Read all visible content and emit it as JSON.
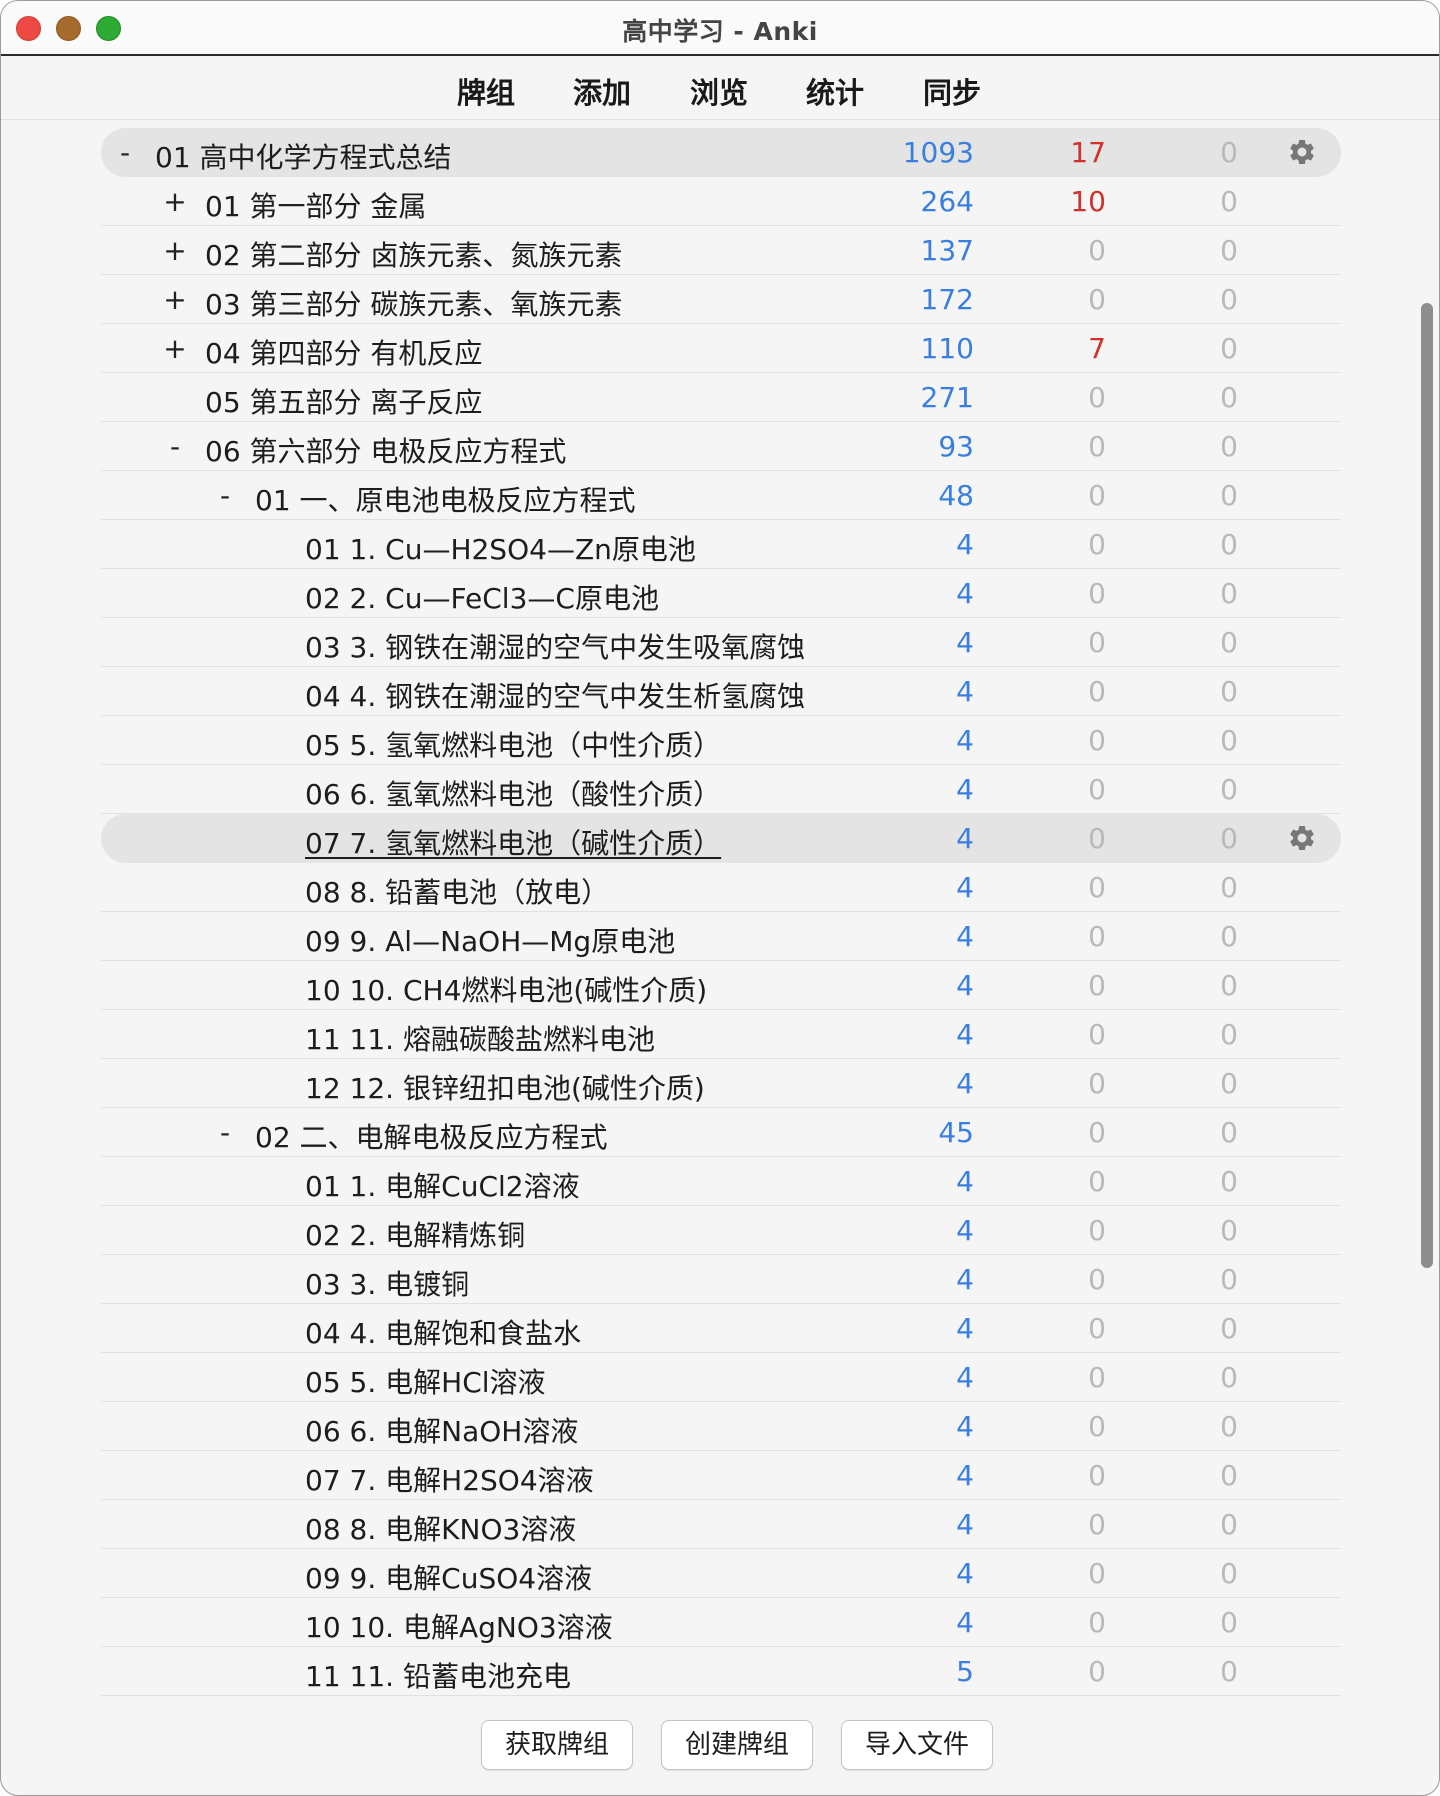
{
  "window": {
    "title": "高中学习 - Anki"
  },
  "toolbar": {
    "decks": "牌组",
    "add": "添加",
    "browse": "浏览",
    "stats": "统计",
    "sync": "同步"
  },
  "decks": [
    {
      "expander": "-",
      "name": "01 高中化学方程式总结",
      "new": "1093",
      "learn": "17",
      "review": "0",
      "level": 0,
      "gear": true,
      "current": true
    },
    {
      "expander": "+",
      "name": "01 第一部分 金属",
      "new": "264",
      "learn": "10",
      "review": "0",
      "level": 1
    },
    {
      "expander": "+",
      "name": "02 第二部分 卤族元素、氮族元素",
      "new": "137",
      "learn": "0",
      "review": "0",
      "level": 1
    },
    {
      "expander": "+",
      "name": "03 第三部分 碳族元素、氧族元素",
      "new": "172",
      "learn": "0",
      "review": "0",
      "level": 1
    },
    {
      "expander": "+",
      "name": "04 第四部分 有机反应",
      "new": "110",
      "learn": "7",
      "review": "0",
      "level": 1
    },
    {
      "expander": "",
      "name": "05 第五部分 离子反应",
      "new": "271",
      "learn": "0",
      "review": "0",
      "level": 1
    },
    {
      "expander": "-",
      "name": "06 第六部分 电极反应方程式",
      "new": "93",
      "learn": "0",
      "review": "0",
      "level": 1
    },
    {
      "expander": "-",
      "name": "01 一、原电池电极反应方程式",
      "new": "48",
      "learn": "0",
      "review": "0",
      "level": 2
    },
    {
      "expander": "",
      "name": "01 1.  Cu—H2SO4—Zn原电池",
      "new": "4",
      "learn": "0",
      "review": "0",
      "level": 3
    },
    {
      "expander": "",
      "name": "02 2.  Cu—FeCl3—C原电池",
      "new": "4",
      "learn": "0",
      "review": "0",
      "level": 3
    },
    {
      "expander": "",
      "name": "03 3.  钢铁在潮湿的空气中发生吸氧腐蚀",
      "new": "4",
      "learn": "0",
      "review": "0",
      "level": 3
    },
    {
      "expander": "",
      "name": "04 4.  钢铁在潮湿的空气中发生析氢腐蚀",
      "new": "4",
      "learn": "0",
      "review": "0",
      "level": 3
    },
    {
      "expander": "",
      "name": "05 5.  氢氧燃料电池（中性介质）",
      "new": "4",
      "learn": "0",
      "review": "0",
      "level": 3
    },
    {
      "expander": "",
      "name": "06 6.  氢氧燃料电池（酸性介质）",
      "new": "4",
      "learn": "0",
      "review": "0",
      "level": 3
    },
    {
      "expander": "",
      "name": "07 7.  氢氧燃料电池（碱性介质）",
      "new": "4",
      "learn": "0",
      "review": "0",
      "level": 3,
      "gear": true,
      "current": true,
      "selected": true
    },
    {
      "expander": "",
      "name": "08 8.  铅蓄电池（放电）",
      "new": "4",
      "learn": "0",
      "review": "0",
      "level": 3
    },
    {
      "expander": "",
      "name": "09 9.  Al—NaOH—Mg原电池",
      "new": "4",
      "learn": "0",
      "review": "0",
      "level": 3
    },
    {
      "expander": "",
      "name": "10 10.  CH4燃料电池(碱性介质)",
      "new": "4",
      "learn": "0",
      "review": "0",
      "level": 3
    },
    {
      "expander": "",
      "name": "11 11.  熔融碳酸盐燃料电池",
      "new": "4",
      "learn": "0",
      "review": "0",
      "level": 3
    },
    {
      "expander": "",
      "name": "12 12.  银锌纽扣电池(碱性介质)",
      "new": "4",
      "learn": "0",
      "review": "0",
      "level": 3
    },
    {
      "expander": "-",
      "name": "02 二、电解电极反应方程式",
      "new": "45",
      "learn": "0",
      "review": "0",
      "level": 2
    },
    {
      "expander": "",
      "name": "01 1.  电解CuCl2溶液",
      "new": "4",
      "learn": "0",
      "review": "0",
      "level": 3
    },
    {
      "expander": "",
      "name": "02 2.  电解精炼铜",
      "new": "4",
      "learn": "0",
      "review": "0",
      "level": 3
    },
    {
      "expander": "",
      "name": "03 3.  电镀铜",
      "new": "4",
      "learn": "0",
      "review": "0",
      "level": 3
    },
    {
      "expander": "",
      "name": "04 4.  电解饱和食盐水",
      "new": "4",
      "learn": "0",
      "review": "0",
      "level": 3
    },
    {
      "expander": "",
      "name": "05 5.  电解HCl溶液",
      "new": "4",
      "learn": "0",
      "review": "0",
      "level": 3
    },
    {
      "expander": "",
      "name": "06 6.  电解NaOH溶液",
      "new": "4",
      "learn": "0",
      "review": "0",
      "level": 3
    },
    {
      "expander": "",
      "name": "07 7.  电解H2SO4溶液",
      "new": "4",
      "learn": "0",
      "review": "0",
      "level": 3
    },
    {
      "expander": "",
      "name": "08 8.  电解KNO3溶液",
      "new": "4",
      "learn": "0",
      "review": "0",
      "level": 3
    },
    {
      "expander": "",
      "name": "09 9.  电解CuSO4溶液",
      "new": "4",
      "learn": "0",
      "review": "0",
      "level": 3
    },
    {
      "expander": "",
      "name": "10 10.  电解AgNO3溶液",
      "new": "4",
      "learn": "0",
      "review": "0",
      "level": 3
    },
    {
      "expander": "",
      "name": "11 11.  铅蓄电池充电",
      "new": "5",
      "learn": "0",
      "review": "0",
      "level": 3
    }
  ],
  "buttons": {
    "get_shared": "获取牌组",
    "create_deck": "创建牌组",
    "import_file": "导入文件"
  },
  "icons": {
    "gear": "gear-icon",
    "close": "close-window-icon",
    "minimize": "minimize-window-icon",
    "zoom": "zoom-window-icon"
  },
  "colors": {
    "new_count": "#3a7fe0",
    "learn_count": "#d0312d",
    "zero_count": "#b9b9b9",
    "current_row": "#e4e4e4"
  }
}
